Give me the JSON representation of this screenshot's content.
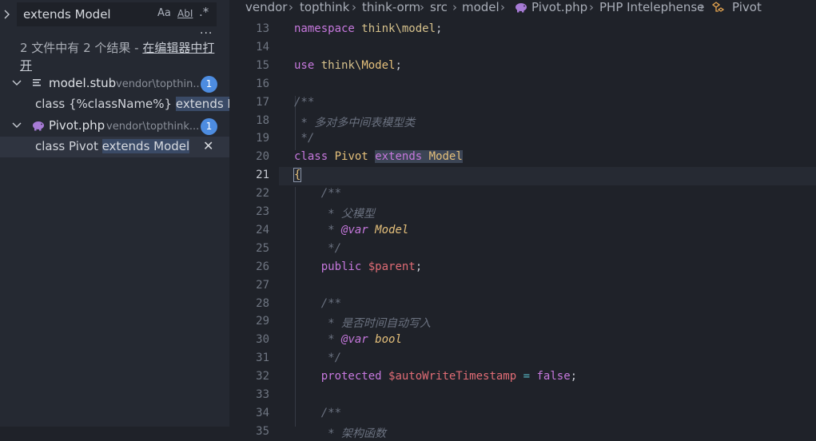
{
  "search": {
    "query": "extends Model",
    "case_label": "Aa",
    "word_label": "AbI",
    "regex_label": ".*",
    "more_label": "...",
    "summary": "2 文件中有 2 个结果 - ",
    "open_in_editor": "在编辑器中打开"
  },
  "results": [
    {
      "file": "model.stub",
      "path": "vendor\\topthin...",
      "count": "1",
      "icon": "file-lines-icon",
      "matches": [
        {
          "before": "class {%className%} ",
          "hit": "extends Mo...",
          "after": ""
        }
      ]
    },
    {
      "file": "Pivot.php",
      "path": "vendor\\topthink...",
      "count": "1",
      "icon": "php-elephant-icon",
      "matches": [
        {
          "before": "class Pivot ",
          "hit": "extends Model",
          "after": ""
        }
      ]
    }
  ],
  "breadcrumbs": [
    "vendor",
    "topthink",
    "think-orm",
    "src",
    "model",
    "Pivot.php",
    "PHP Intelephense",
    "Pivot"
  ],
  "editor": {
    "current_line": 21,
    "lines": [
      {
        "n": 13,
        "tokens": [
          [
            "kw",
            "namespace"
          ],
          [
            "pun",
            " "
          ],
          [
            "ns",
            "think\\model"
          ],
          [
            "pun",
            ";"
          ]
        ]
      },
      {
        "n": 14,
        "tokens": []
      },
      {
        "n": 15,
        "tokens": [
          [
            "kw",
            "use"
          ],
          [
            "pun",
            " "
          ],
          [
            "ns",
            "think\\"
          ],
          [
            "cls",
            "Model"
          ],
          [
            "pun",
            ";"
          ]
        ]
      },
      {
        "n": 16,
        "tokens": []
      },
      {
        "n": 17,
        "tokens": [
          [
            "cmt",
            "/**"
          ]
        ]
      },
      {
        "n": 18,
        "tokens": [
          [
            "cmt",
            " * "
          ],
          [
            "cmt cmt-zh",
            "多对多中间表模型类"
          ]
        ]
      },
      {
        "n": 19,
        "tokens": [
          [
            "cmt",
            " */"
          ]
        ]
      },
      {
        "n": 20,
        "tokens": [
          [
            "kw",
            "class"
          ],
          [
            "pun",
            " "
          ],
          [
            "cls",
            "Pivot"
          ],
          [
            "pun",
            " "
          ],
          [
            "kw sel",
            "extends"
          ],
          [
            "sel",
            " "
          ],
          [
            "cls sel",
            "Model"
          ]
        ]
      },
      {
        "n": 21,
        "tokens": [
          [
            "brace",
            "{"
          ]
        ]
      },
      {
        "n": 22,
        "tokens": [
          [
            "pun",
            "    "
          ],
          [
            "cmt",
            "/**"
          ]
        ]
      },
      {
        "n": 23,
        "tokens": [
          [
            "pun",
            "     "
          ],
          [
            "cmt",
            "* "
          ],
          [
            "cmt cmt-zh",
            "父模型"
          ]
        ]
      },
      {
        "n": 24,
        "tokens": [
          [
            "pun",
            "     "
          ],
          [
            "cmt",
            "* "
          ],
          [
            "doc-tag",
            "@var"
          ],
          [
            "cmt",
            " "
          ],
          [
            "doc-type",
            "Model"
          ]
        ]
      },
      {
        "n": 25,
        "tokens": [
          [
            "pun",
            "     "
          ],
          [
            "cmt",
            "*/"
          ]
        ]
      },
      {
        "n": 26,
        "tokens": [
          [
            "pun",
            "    "
          ],
          [
            "kw",
            "public"
          ],
          [
            "pun",
            " "
          ],
          [
            "var",
            "$parent"
          ],
          [
            "pun",
            ";"
          ]
        ]
      },
      {
        "n": 27,
        "tokens": []
      },
      {
        "n": 28,
        "tokens": [
          [
            "pun",
            "    "
          ],
          [
            "cmt",
            "/**"
          ]
        ]
      },
      {
        "n": 29,
        "tokens": [
          [
            "pun",
            "     "
          ],
          [
            "cmt",
            "* "
          ],
          [
            "cmt cmt-zh",
            "是否时间自动写入"
          ]
        ]
      },
      {
        "n": 30,
        "tokens": [
          [
            "pun",
            "     "
          ],
          [
            "cmt",
            "* "
          ],
          [
            "doc-tag",
            "@var"
          ],
          [
            "cmt",
            " "
          ],
          [
            "doc-type",
            "bool"
          ]
        ]
      },
      {
        "n": 31,
        "tokens": [
          [
            "pun",
            "     "
          ],
          [
            "cmt",
            "*/"
          ]
        ]
      },
      {
        "n": 32,
        "tokens": [
          [
            "pun",
            "    "
          ],
          [
            "kw",
            "protected"
          ],
          [
            "pun",
            " "
          ],
          [
            "var",
            "$autoWriteTimestamp"
          ],
          [
            "pun",
            " "
          ],
          [
            "op",
            "="
          ],
          [
            "pun",
            " "
          ],
          [
            "kw",
            "false"
          ],
          [
            "pun",
            ";"
          ]
        ]
      },
      {
        "n": 33,
        "tokens": []
      },
      {
        "n": 34,
        "tokens": [
          [
            "pun",
            "    "
          ],
          [
            "cmt",
            "/**"
          ]
        ]
      },
      {
        "n": 35,
        "tokens": [
          [
            "pun",
            "     "
          ],
          [
            "cmt",
            "* "
          ],
          [
            "cmt cmt-zh",
            "架构函数"
          ]
        ]
      }
    ]
  }
}
